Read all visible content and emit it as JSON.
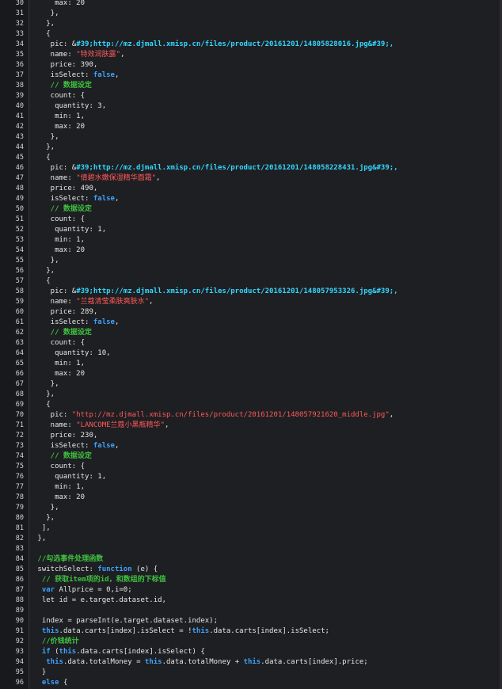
{
  "editor": {
    "lines": [
      {
        "n": "30",
        "tokens": [
          {
            "t": "     max: 20",
            "c": "pl"
          }
        ]
      },
      {
        "n": "31",
        "tokens": [
          {
            "t": "    },",
            "c": "pl"
          }
        ]
      },
      {
        "n": "32",
        "tokens": [
          {
            "t": "   },",
            "c": "pl"
          }
        ]
      },
      {
        "n": "33",
        "tokens": [
          {
            "t": "   {",
            "c": "pl"
          }
        ]
      },
      {
        "n": "34",
        "tokens": [
          {
            "t": "    pic: ",
            "c": "pl"
          },
          {
            "t": "&",
            "c": "pl"
          },
          {
            "t": "#39;http://mz.djmall.xmisp.cn/files/product/20161201/14805828016.jpg&#39;,",
            "c": "url"
          }
        ]
      },
      {
        "n": "35",
        "tokens": [
          {
            "t": "    name: ",
            "c": "pl"
          },
          {
            "t": "\"特效润肤露\"",
            "c": "str"
          },
          {
            "t": ",",
            "c": "pl"
          }
        ]
      },
      {
        "n": "36",
        "tokens": [
          {
            "t": "    price: 390,",
            "c": "pl"
          }
        ]
      },
      {
        "n": "37",
        "tokens": [
          {
            "t": "    isSelect: ",
            "c": "pl"
          },
          {
            "t": "false",
            "c": "kw"
          },
          {
            "t": ",",
            "c": "pl"
          }
        ]
      },
      {
        "n": "38",
        "tokens": [
          {
            "t": "    // 数据设定",
            "c": "cm"
          }
        ]
      },
      {
        "n": "39",
        "tokens": [
          {
            "t": "    count: {",
            "c": "pl"
          }
        ]
      },
      {
        "n": "40",
        "tokens": [
          {
            "t": "     quantity: 3,",
            "c": "pl"
          }
        ]
      },
      {
        "n": "41",
        "tokens": [
          {
            "t": "     min: 1,",
            "c": "pl"
          }
        ]
      },
      {
        "n": "42",
        "tokens": [
          {
            "t": "     max: 20",
            "c": "pl"
          }
        ]
      },
      {
        "n": "43",
        "tokens": [
          {
            "t": "    },",
            "c": "pl"
          }
        ]
      },
      {
        "n": "44",
        "tokens": [
          {
            "t": "   },",
            "c": "pl"
          }
        ]
      },
      {
        "n": "45",
        "tokens": [
          {
            "t": "   {",
            "c": "pl"
          }
        ]
      },
      {
        "n": "46",
        "tokens": [
          {
            "t": "    pic: ",
            "c": "pl"
          },
          {
            "t": "&",
            "c": "pl"
          },
          {
            "t": "#39;http://mz.djmall.xmisp.cn/files/product/20161201/148058228431.jpg&#39;,",
            "c": "url"
          }
        ]
      },
      {
        "n": "47",
        "tokens": [
          {
            "t": "    name: ",
            "c": "pl"
          },
          {
            "t": "\"倩碧水嫩保湿精华面霜\"",
            "c": "str"
          },
          {
            "t": ",",
            "c": "pl"
          }
        ]
      },
      {
        "n": "48",
        "tokens": [
          {
            "t": "    price: 490,",
            "c": "pl"
          }
        ]
      },
      {
        "n": "49",
        "tokens": [
          {
            "t": "    isSelect: ",
            "c": "pl"
          },
          {
            "t": "false",
            "c": "kw"
          },
          {
            "t": ",",
            "c": "pl"
          }
        ]
      },
      {
        "n": "50",
        "tokens": [
          {
            "t": "    // 数据设定",
            "c": "cm"
          }
        ]
      },
      {
        "n": "51",
        "tokens": [
          {
            "t": "    count: {",
            "c": "pl"
          }
        ]
      },
      {
        "n": "52",
        "tokens": [
          {
            "t": "     quantity: 1,",
            "c": "pl"
          }
        ]
      },
      {
        "n": "53",
        "tokens": [
          {
            "t": "     min: 1,",
            "c": "pl"
          }
        ]
      },
      {
        "n": "54",
        "tokens": [
          {
            "t": "     max: 20",
            "c": "pl"
          }
        ]
      },
      {
        "n": "55",
        "tokens": [
          {
            "t": "    },",
            "c": "pl"
          }
        ]
      },
      {
        "n": "56",
        "tokens": [
          {
            "t": "   },",
            "c": "pl"
          }
        ]
      },
      {
        "n": "57",
        "tokens": [
          {
            "t": "   {",
            "c": "pl"
          }
        ]
      },
      {
        "n": "58",
        "tokens": [
          {
            "t": "    pic: ",
            "c": "pl"
          },
          {
            "t": "&",
            "c": "pl"
          },
          {
            "t": "#39;http://mz.djmall.xmisp.cn/files/product/20161201/148057953326.jpg&#39;,",
            "c": "url"
          }
        ]
      },
      {
        "n": "59",
        "tokens": [
          {
            "t": "    name: ",
            "c": "pl"
          },
          {
            "t": "\"兰蔻清莹柔肤爽肤水\"",
            "c": "str"
          },
          {
            "t": ",",
            "c": "pl"
          }
        ]
      },
      {
        "n": "60",
        "tokens": [
          {
            "t": "    price: 289,",
            "c": "pl"
          }
        ]
      },
      {
        "n": "61",
        "tokens": [
          {
            "t": "    isSelect: ",
            "c": "pl"
          },
          {
            "t": "false",
            "c": "kw"
          },
          {
            "t": ",",
            "c": "pl"
          }
        ]
      },
      {
        "n": "62",
        "tokens": [
          {
            "t": "    // 数据设定",
            "c": "cm"
          }
        ]
      },
      {
        "n": "63",
        "tokens": [
          {
            "t": "    count: {",
            "c": "pl"
          }
        ]
      },
      {
        "n": "64",
        "tokens": [
          {
            "t": "     quantity: 10,",
            "c": "pl"
          }
        ]
      },
      {
        "n": "65",
        "tokens": [
          {
            "t": "     min: 1,",
            "c": "pl"
          }
        ]
      },
      {
        "n": "66",
        "tokens": [
          {
            "t": "     max: 20",
            "c": "pl"
          }
        ]
      },
      {
        "n": "67",
        "tokens": [
          {
            "t": "    },",
            "c": "pl"
          }
        ]
      },
      {
        "n": "68",
        "tokens": [
          {
            "t": "   },",
            "c": "pl"
          }
        ]
      },
      {
        "n": "69",
        "tokens": [
          {
            "t": "   {",
            "c": "pl"
          }
        ]
      },
      {
        "n": "70",
        "tokens": [
          {
            "t": "    pic: ",
            "c": "pl"
          },
          {
            "t": "\"http://mz.djmall.xmisp.cn/files/product/20161201/148057921620_middle.jpg\"",
            "c": "str"
          },
          {
            "t": ",",
            "c": "pl"
          }
        ]
      },
      {
        "n": "71",
        "tokens": [
          {
            "t": "    name: ",
            "c": "pl"
          },
          {
            "t": "\"LANCOME兰蔻小黑瓶精华\"",
            "c": "str"
          },
          {
            "t": ",",
            "c": "pl"
          }
        ]
      },
      {
        "n": "72",
        "tokens": [
          {
            "t": "    price: 230,",
            "c": "pl"
          }
        ]
      },
      {
        "n": "73",
        "tokens": [
          {
            "t": "    isSelect: ",
            "c": "pl"
          },
          {
            "t": "false",
            "c": "kw"
          },
          {
            "t": ",",
            "c": "pl"
          }
        ]
      },
      {
        "n": "74",
        "tokens": [
          {
            "t": "    // 数据设定",
            "c": "cm"
          }
        ]
      },
      {
        "n": "75",
        "tokens": [
          {
            "t": "    count: {",
            "c": "pl"
          }
        ]
      },
      {
        "n": "76",
        "tokens": [
          {
            "t": "     quantity: 1,",
            "c": "pl"
          }
        ]
      },
      {
        "n": "77",
        "tokens": [
          {
            "t": "     min: 1,",
            "c": "pl"
          }
        ]
      },
      {
        "n": "78",
        "tokens": [
          {
            "t": "     max: 20",
            "c": "pl"
          }
        ]
      },
      {
        "n": "79",
        "tokens": [
          {
            "t": "    },",
            "c": "pl"
          }
        ]
      },
      {
        "n": "80",
        "tokens": [
          {
            "t": "   },",
            "c": "pl"
          }
        ]
      },
      {
        "n": "81",
        "tokens": [
          {
            "t": "  ],",
            "c": "pl"
          }
        ]
      },
      {
        "n": "82",
        "tokens": [
          {
            "t": " },",
            "c": "pl"
          }
        ]
      },
      {
        "n": "83",
        "tokens": [
          {
            "t": "",
            "c": "pl"
          }
        ]
      },
      {
        "n": "84",
        "tokens": [
          {
            "t": " //勾选事件处理函数",
            "c": "cm"
          }
        ]
      },
      {
        "n": "85",
        "tokens": [
          {
            "t": " switchSelect: ",
            "c": "pl"
          },
          {
            "t": "function",
            "c": "kw"
          },
          {
            "t": " (e) {",
            "c": "pl"
          }
        ]
      },
      {
        "n": "86",
        "tokens": [
          {
            "t": "  // 获取item项的id，和数组的下标值",
            "c": "cm"
          }
        ]
      },
      {
        "n": "87",
        "tokens": [
          {
            "t": "  ",
            "c": "pl"
          },
          {
            "t": "var",
            "c": "kw"
          },
          {
            "t": " Allprice = 0,i=0;",
            "c": "pl"
          }
        ]
      },
      {
        "n": "88",
        "tokens": [
          {
            "t": "  let id = e.target.dataset.id,",
            "c": "pl"
          }
        ]
      },
      {
        "n": "89",
        "tokens": [
          {
            "t": "",
            "c": "pl"
          }
        ]
      },
      {
        "n": "90",
        "tokens": [
          {
            "t": "  index = parseInt(e.target.dataset.index);",
            "c": "pl"
          }
        ]
      },
      {
        "n": "91",
        "tokens": [
          {
            "t": "  ",
            "c": "pl"
          },
          {
            "t": "this",
            "c": "kw"
          },
          {
            "t": ".data.carts[index].isSelect = !",
            "c": "pl"
          },
          {
            "t": "this",
            "c": "kw"
          },
          {
            "t": ".data.carts[index].isSelect;",
            "c": "pl"
          }
        ]
      },
      {
        "n": "92",
        "tokens": [
          {
            "t": "  //价钱统计",
            "c": "cm"
          }
        ]
      },
      {
        "n": "93",
        "tokens": [
          {
            "t": "  ",
            "c": "pl"
          },
          {
            "t": "if",
            "c": "kw"
          },
          {
            "t": " (",
            "c": "pl"
          },
          {
            "t": "this",
            "c": "kw"
          },
          {
            "t": ".data.carts[index].isSelect) {",
            "c": "pl"
          }
        ]
      },
      {
        "n": "94",
        "tokens": [
          {
            "t": "   ",
            "c": "pl"
          },
          {
            "t": "this",
            "c": "kw"
          },
          {
            "t": ".data.totalMoney = ",
            "c": "pl"
          },
          {
            "t": "this",
            "c": "kw"
          },
          {
            "t": ".data.totalMoney + ",
            "c": "pl"
          },
          {
            "t": "this",
            "c": "kw"
          },
          {
            "t": ".data.carts[index].price;",
            "c": "pl"
          }
        ]
      },
      {
        "n": "95",
        "tokens": [
          {
            "t": "  }",
            "c": "pl"
          }
        ]
      },
      {
        "n": "96",
        "tokens": [
          {
            "t": "  ",
            "c": "pl"
          },
          {
            "t": "else",
            "c": "kw"
          },
          {
            "t": " {",
            "c": "pl"
          }
        ]
      }
    ]
  }
}
